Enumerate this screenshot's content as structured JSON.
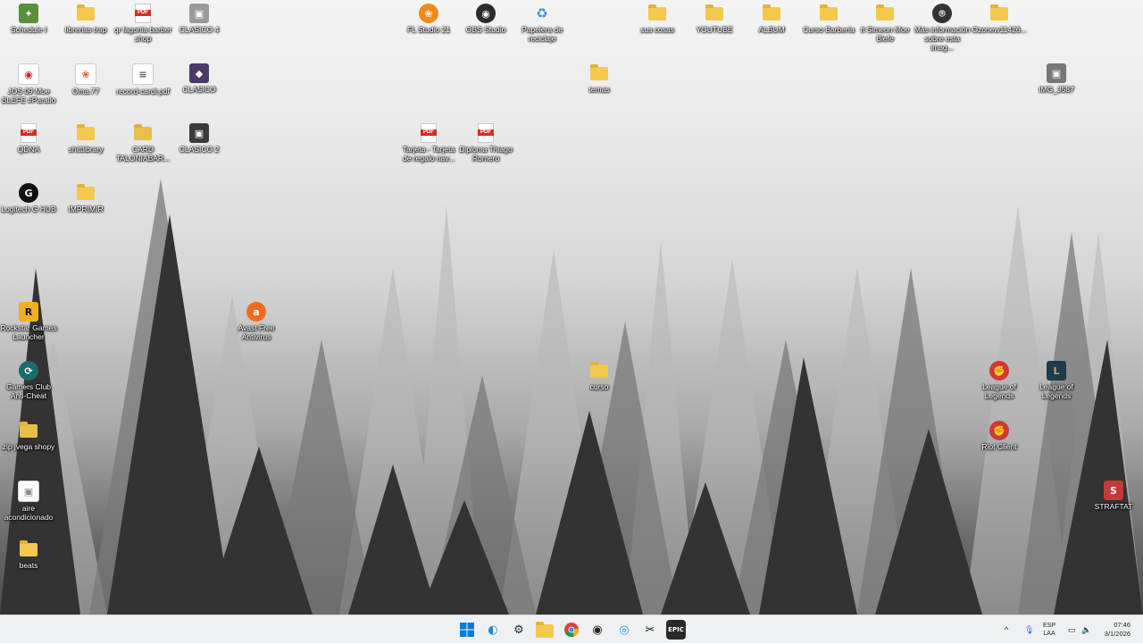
{
  "desktop_icons": [
    {
      "label": "Schedule I",
      "icon": "schedule-app-icon"
    },
    {
      "label": "librerias trap",
      "icon": "folder-icon"
    },
    {
      "label": "qr lagonia barber shop",
      "icon": "pdf-icon"
    },
    {
      "label": "CLASICO 4",
      "icon": "image-file-icon"
    },
    {
      "label": "FL Studio 21",
      "icon": "fl-studio-icon"
    },
    {
      "label": "OBS Studio",
      "icon": "obs-icon"
    },
    {
      "label": "Papelera de reciclaje",
      "icon": "recycle-bin-icon"
    },
    {
      "label": "sus cosas",
      "icon": "folder-icon"
    },
    {
      "label": "YOUTUBE",
      "icon": "folder-icon"
    },
    {
      "label": "ALBUM",
      "icon": "folder-icon"
    },
    {
      "label": "Curso Barbería",
      "icon": "folder-icon"
    },
    {
      "label": "ft Simeon Moe Blefe",
      "icon": "folder-icon"
    },
    {
      "label": "Más información sobre esta imag...",
      "icon": "info-camera-icon"
    },
    {
      "label": "Ozonew11426...",
      "icon": "folder-icon"
    },
    {
      "label": "JOS 09 Moe BLEFE #Parallo",
      "icon": "audio-file-icon"
    },
    {
      "label": "Oma.77",
      "icon": "project-file-icon"
    },
    {
      "label": "record-cardi.pdf",
      "icon": "doc-file-icon"
    },
    {
      "label": "CLASICO",
      "icon": "media-file-icon"
    },
    {
      "label": "temas",
      "icon": "folder-icon"
    },
    {
      "label": "IMG_3587",
      "icon": "image-file-icon"
    },
    {
      "label": "QDNA",
      "icon": "pdf-icon"
    },
    {
      "label": "shittlibrary",
      "icon": "folder-icon"
    },
    {
      "label": "CARD TALONIABAR...",
      "icon": "zip-folder-icon"
    },
    {
      "label": "CLASICO 2",
      "icon": "image-file-icon"
    },
    {
      "label": "Tarjeta - Tarjeta de regalo nav...",
      "icon": "pdf-icon"
    },
    {
      "label": "Diploma Thiago Romero",
      "icon": "pdf-icon"
    },
    {
      "label": "Logitech G HUB",
      "icon": "logitech-icon"
    },
    {
      "label": "IMPRIMIR",
      "icon": "folder-icon"
    },
    {
      "label": "Rockstar Games Launcher",
      "icon": "rockstar-icon"
    },
    {
      "label": "Avast Free Antivirus",
      "icon": "avast-icon"
    },
    {
      "label": "Gamers Club Anti-Cheat",
      "icon": "gamers-club-icon"
    },
    {
      "label": "curso",
      "icon": "folder-icon"
    },
    {
      "label": "League of Legends",
      "icon": "riot-icon"
    },
    {
      "label": "League of Legends",
      "icon": "league-icon"
    },
    {
      "label": "zip jvega shopy",
      "icon": "zip-folder-icon"
    },
    {
      "label": "Riot Client",
      "icon": "riot-icon"
    },
    {
      "label": "aire acondicionado",
      "icon": "image-file-icon"
    },
    {
      "label": "STRAFTAT",
      "icon": "straftat-icon"
    },
    {
      "label": "beats",
      "icon": "folder-icon"
    }
  ],
  "taskbar": {
    "apps": [
      {
        "name": "Start",
        "icon": "windows-start-icon"
      },
      {
        "name": "Microsoft Edge",
        "icon": "edge-icon"
      },
      {
        "name": "Steam",
        "icon": "steam-icon"
      },
      {
        "name": "File Explorer",
        "icon": "file-explorer-icon"
      },
      {
        "name": "Google Chrome",
        "icon": "chrome-icon"
      },
      {
        "name": "OBS Studio",
        "icon": "obs-icon"
      },
      {
        "name": "Copilot",
        "icon": "copilot-icon"
      },
      {
        "name": "CapCut",
        "icon": "capcut-icon"
      },
      {
        "name": "Epic Games Launcher",
        "icon": "epic-games-icon"
      }
    ],
    "tray": {
      "language_line1": "ESP",
      "language_line2": "LAA",
      "time": "07:46",
      "date": "3/1/2026"
    }
  }
}
